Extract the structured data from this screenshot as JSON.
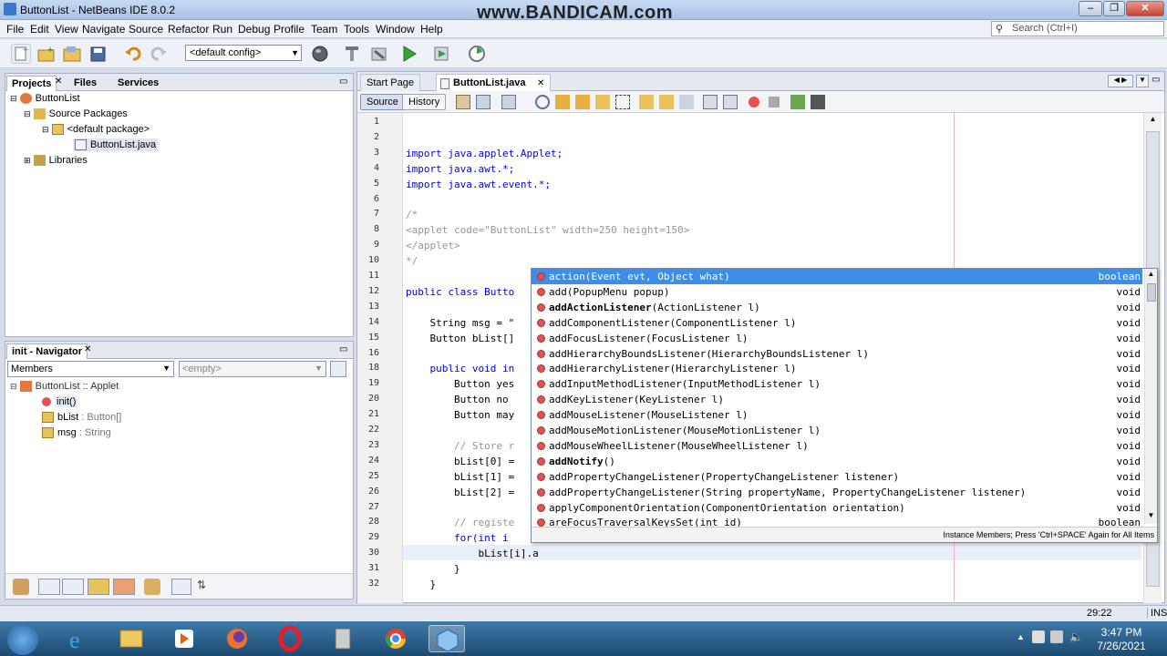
{
  "window": {
    "title": "ButtonList - NetBeans IDE 8.0.2",
    "watermark": "www.BANDICAM.com"
  },
  "menu": [
    "File",
    "Edit",
    "View",
    "Navigate",
    "Source",
    "Refactor",
    "Run",
    "Debug",
    "Profile",
    "Team",
    "Tools",
    "Window",
    "Help"
  ],
  "search": {
    "placeholder": "Search (Ctrl+I)"
  },
  "toolbar": {
    "config": "<default config>"
  },
  "projects": {
    "tabs": [
      "Projects",
      "Files",
      "Services"
    ],
    "tree": [
      "ButtonList",
      "Source Packages",
      "<default package>",
      "ButtonList.java",
      "Libraries"
    ]
  },
  "navigator": {
    "title": "init - Navigator",
    "members_select": "Members",
    "filter_select": "<empty>",
    "root": "ButtonList :: Applet",
    "items": [
      {
        "name": "init()",
        "type": ""
      },
      {
        "name": "bList",
        "type": " : Button[]"
      },
      {
        "name": "msg",
        "type": " : String"
      }
    ]
  },
  "editor": {
    "tabs": [
      "Start Page",
      "ButtonList.java"
    ],
    "source_btn": "Source",
    "history_btn": "History",
    "line_numbers": [
      "1",
      "2",
      "3",
      "4",
      "5",
      "6",
      "7",
      "8",
      "9",
      "10",
      "11",
      "12",
      "13",
      "14",
      "15",
      "16",
      "18",
      "19",
      "20",
      "21",
      "22",
      "23",
      "24",
      "25",
      "26",
      "27",
      "28",
      "29",
      "30",
      "31",
      "32"
    ],
    "lines": [
      "",
      "",
      "import java.applet.Applet;",
      "import java.awt.*;",
      "import java.awt.event.*;",
      "",
      "/*",
      "<applet code=\"ButtonList\" width=250 height=150>",
      "</applet>",
      "*/",
      "",
      "public class Butto",
      "",
      "    String msg = \"",
      "    Button bList[]",
      "",
      "    public void in",
      "        Button yes",
      "        Button no",
      "        Button may",
      "",
      "        // Store r",
      "        bList[0] =",
      "        bList[1] =",
      "        bList[2] =",
      "",
      "        // registe",
      "        for(int i",
      "            bList[i].a",
      "        }",
      "    }"
    ]
  },
  "completion": {
    "items": [
      {
        "name": "action",
        "params": "(Event evt, Object what)",
        "ret": "boolean"
      },
      {
        "name": "add",
        "params": "(PopupMenu popup)",
        "ret": "void"
      },
      {
        "name": "addActionListener",
        "params": "(ActionListener l)",
        "ret": "void"
      },
      {
        "name": "addComponentListener",
        "params": "(ComponentListener l)",
        "ret": "void"
      },
      {
        "name": "addFocusListener",
        "params": "(FocusListener l)",
        "ret": "void"
      },
      {
        "name": "addHierarchyBoundsListener",
        "params": "(HierarchyBoundsListener l)",
        "ret": "void"
      },
      {
        "name": "addHierarchyListener",
        "params": "(HierarchyListener l)",
        "ret": "void"
      },
      {
        "name": "addInputMethodListener",
        "params": "(InputMethodListener l)",
        "ret": "void"
      },
      {
        "name": "addKeyListener",
        "params": "(KeyListener l)",
        "ret": "void"
      },
      {
        "name": "addMouseListener",
        "params": "(MouseListener l)",
        "ret": "void"
      },
      {
        "name": "addMouseMotionListener",
        "params": "(MouseMotionListener l)",
        "ret": "void"
      },
      {
        "name": "addMouseWheelListener",
        "params": "(MouseWheelListener l)",
        "ret": "void"
      },
      {
        "name": "addNotify",
        "params": "()",
        "ret": "void"
      },
      {
        "name": "addPropertyChangeListener",
        "params": "(PropertyChangeListener listener)",
        "ret": "void"
      },
      {
        "name": "addPropertyChangeListener",
        "params": "(String propertyName, PropertyChangeListener listener)",
        "ret": "void"
      },
      {
        "name": "applyComponentOrientation",
        "params": "(ComponentOrientation orientation)",
        "ret": "void"
      },
      {
        "name": "areFocusTraversalKeysSet",
        "params": "(int id)",
        "ret": "boolean"
      }
    ],
    "hint": "Instance Members; Press 'Ctrl+SPACE' Again for All Items"
  },
  "status": {
    "position": "29:22",
    "mode": "INS"
  },
  "taskbar": {
    "time": "3:47 PM",
    "date": "7/26/2021"
  }
}
